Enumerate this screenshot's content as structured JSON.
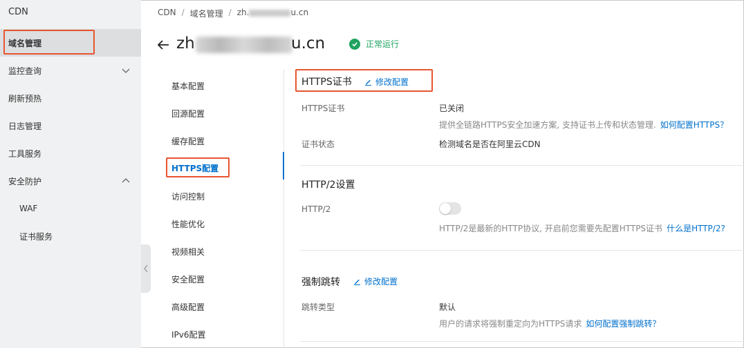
{
  "sidebar": {
    "title": "CDN",
    "items": [
      {
        "label": "域名管理",
        "active": true
      },
      {
        "label": "监控查询",
        "expanded": false
      },
      {
        "label": "刷新预热"
      },
      {
        "label": "日志管理"
      },
      {
        "label": "工具服务"
      },
      {
        "label": "安全防护",
        "expanded": true
      },
      {
        "label": "WAF"
      },
      {
        "label": "证书服务"
      }
    ]
  },
  "breadcrumb": [
    "CDN",
    "域名管理",
    "zh.",
    "u.cn"
  ],
  "header": {
    "domain_prefix": "zh",
    "domain_suffix": "u.cn",
    "status": "正常运行"
  },
  "subnav": {
    "items": [
      "基本配置",
      "回源配置",
      "缓存配置",
      "HTTPS配置",
      "访问控制",
      "性能优化",
      "视频相关",
      "安全配置",
      "高级配置",
      "IPv6配置"
    ],
    "active": "HTTPS配置"
  },
  "https_section": {
    "title": "HTTPS证书",
    "edit_label": "修改配置",
    "cert_label": "HTTPS证书",
    "cert_value": "已关闭",
    "cert_hint": "提供全链路HTTPS安全加速方案, 支持证书上传和状态管理.",
    "cert_hint_link": "如何配置HTTPS？",
    "status_label": "证书状态",
    "status_value": "检测域名是否在阿里云CDN"
  },
  "http2_section": {
    "title": "HTTP/2设置",
    "label": "HTTP/2",
    "enabled": false,
    "hint": "HTTP/2是最新的HTTP协议, 开启前您需要先配置HTTPS证书",
    "hint_link": "什么是HTTP/2?"
  },
  "redirect_section": {
    "title": "强制跳转",
    "edit_label": "修改配置",
    "type_label": "跳转类型",
    "type_value": "默认",
    "hint": "用户的请求将强制重定向为HTTPS请求",
    "hint_link": "如何配置强制跳转？"
  },
  "colors": {
    "accent": "#0070cc",
    "success": "#1fa35f",
    "highlight": "#e8542f",
    "sidebar_bg": "#f0f1f2"
  }
}
